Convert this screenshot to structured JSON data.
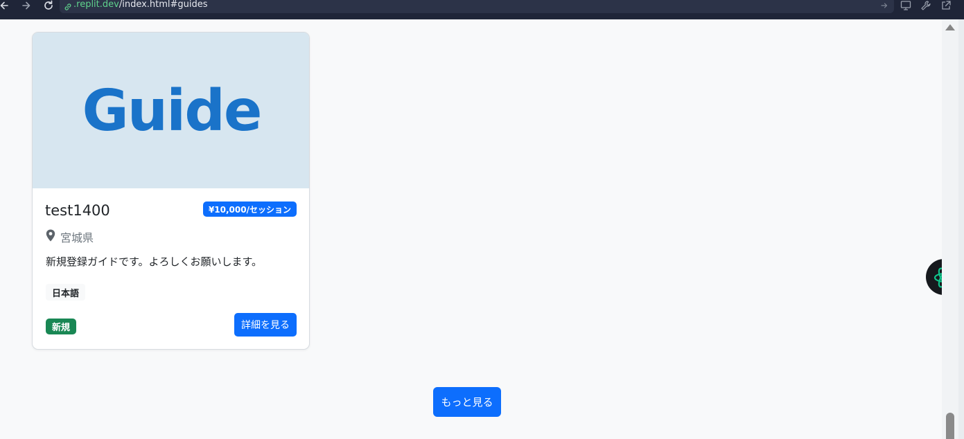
{
  "browser": {
    "url_host": ".replit.dev",
    "url_path": "/index.html#guides"
  },
  "guide_card": {
    "image_text": "Guide",
    "name": "test1400",
    "price": "¥10,000/セッション",
    "location": "宮城県",
    "description": "新規登録ガイドです。よろしくお願いします。",
    "languages": [
      "日本語"
    ],
    "status_badge": "新規",
    "detail_button": "詳細を見る"
  },
  "load_more_button": "もっと見る",
  "colors": {
    "primary": "#0d6efd",
    "success": "#198754",
    "guide_text": "#1a73c9",
    "image_bg": "#d7e6f0",
    "assistant_icon": "#10c48b"
  }
}
